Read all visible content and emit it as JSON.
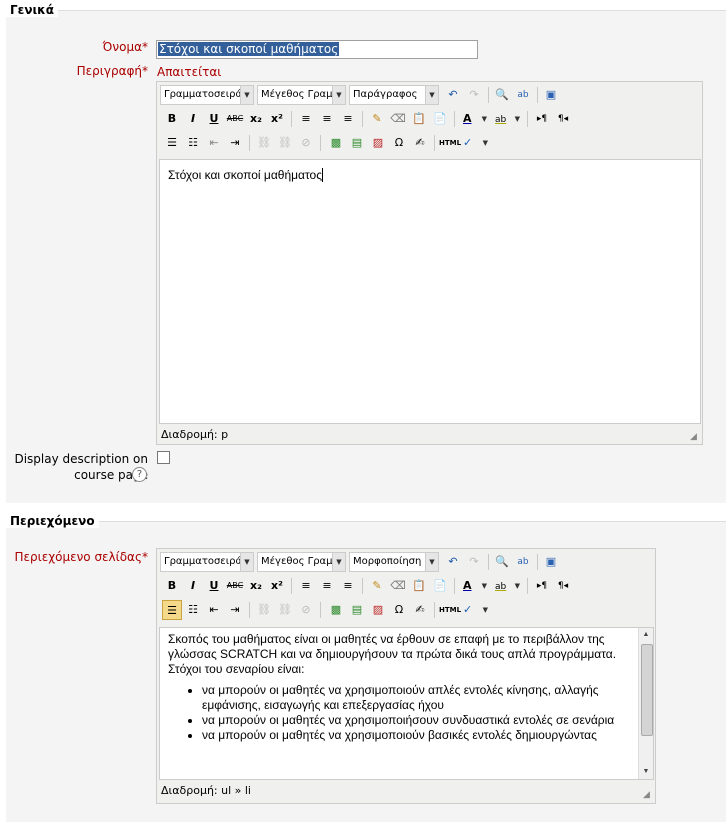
{
  "general": {
    "legend": "Γενικά",
    "name_label": "Όνομα",
    "name_value": "Στόχοι και σκοποί μαθήματος",
    "description_label": "Περιγραφή",
    "required_text": "Απαιτείται",
    "description_text": "Στόχοι και σκοποί μαθήματος",
    "status_path": "Διαδρομή: p",
    "display_label_line1": "Display description on",
    "display_label_line2": "course page",
    "help_glyph": "?"
  },
  "content": {
    "legend": "Περιεχόμενο",
    "page_content_label": "Περιεχόμενο σελίδας",
    "intro": "Σκοπός του μαθήματος είναι οι μαθητές να έρθουν σε επαφή με το περιβάλλον της γλώσσας SCRATCH και να δημιουργήσουν τα πρώτα δικά τους απλά προγράμματα. Στόχοι του σεναρίου είναι:",
    "bullets": [
      "να μπορούν οι μαθητές να χρησιμοποιούν απλές εντολές κίνησης, αλλαγής εμφάνισης, εισαγωγής και επεξεργασίας ήχου",
      "να μπορούν οι μαθητές να χρησιμοποιήσουν συνδυαστικά εντολές σε σενάρια",
      "να μπορούν οι μαθητές να χρησιμοποιούν βασικές εντολές δημιουργώντας"
    ],
    "status_path": "Διαδρομή: ul » li"
  },
  "toolbar": {
    "font_family": "Γραμματοσειρά",
    "font_size": "Μέγεθος Γραμμ",
    "format_1": "Παράγραφος",
    "format_2": "Μορφοποίηση",
    "bold": "B",
    "italic": "I",
    "underline": "U",
    "strike": "ABC",
    "sub": "x₂",
    "sup": "x²",
    "omega": "Ω",
    "html": "HTML"
  },
  "required_star": "*",
  "colors": {
    "required": "#aa0000",
    "legend_bg": "#ffffff",
    "fieldset_bg": "#f4f4f4",
    "editor_bg": "#f0f0ee",
    "active_button": "#f5d98b",
    "selection": "#33609b"
  }
}
